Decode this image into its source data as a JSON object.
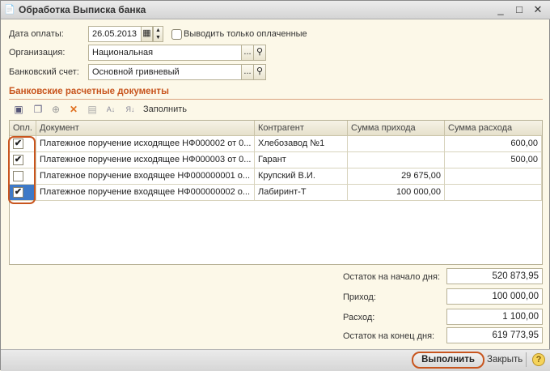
{
  "window": {
    "title": "Обработка  Выписка банка",
    "icon": "document-process-icon"
  },
  "form": {
    "payment_date_label": "Дата оплаты:",
    "payment_date_value": "26.05.2013",
    "only_paid_label": "Выводить только оплаченные",
    "only_paid_checked": false,
    "organization_label": "Организация:",
    "organization_value": "Национальная",
    "bank_account_label": "Банковский счет:",
    "bank_account_value": "Основной гривневый",
    "ellipsis": "..."
  },
  "section": {
    "title": "Банковские расчетные документы"
  },
  "toolbar": {
    "fill_label": "Заполнить"
  },
  "table": {
    "columns": [
      "Опл.",
      "Документ",
      "Контрагент",
      "Сумма прихода",
      "Сумма расхода"
    ],
    "rows": [
      {
        "paid": true,
        "document": "Платежное поручение исходящее НФ000002 от 0...",
        "counterparty": "Хлебозавод №1",
        "income": "",
        "expense": "600,00"
      },
      {
        "paid": true,
        "document": "Платежное поручение исходящее НФ000003 от 0...",
        "counterparty": "Гарант",
        "income": "",
        "expense": "500,00"
      },
      {
        "paid": false,
        "document": "Платежное поручение входящее НФ000000001 о...",
        "counterparty": "Крупский В.И.",
        "income": "29 675,00",
        "expense": ""
      },
      {
        "paid": true,
        "document": "Платежное поручение входящее НФ000000002 о...",
        "counterparty": "Лабиринт-Т",
        "income": "100 000,00",
        "expense": ""
      }
    ]
  },
  "totals": {
    "opening_label": "Остаток на начало дня:",
    "opening_value": "520 873,95",
    "income_label": "Приход:",
    "income_value": "100 000,00",
    "expense_label": "Расход:",
    "expense_value": "1 100,00",
    "closing_label": "Остаток на конец дня:",
    "closing_value": "619 773,95"
  },
  "footer": {
    "run_label": "Выполнить",
    "close_label": "Закрыть",
    "help": "?"
  },
  "colors": {
    "accent": "#c8551e",
    "background": "#fcf8e8",
    "selected": "#3d79c8"
  }
}
